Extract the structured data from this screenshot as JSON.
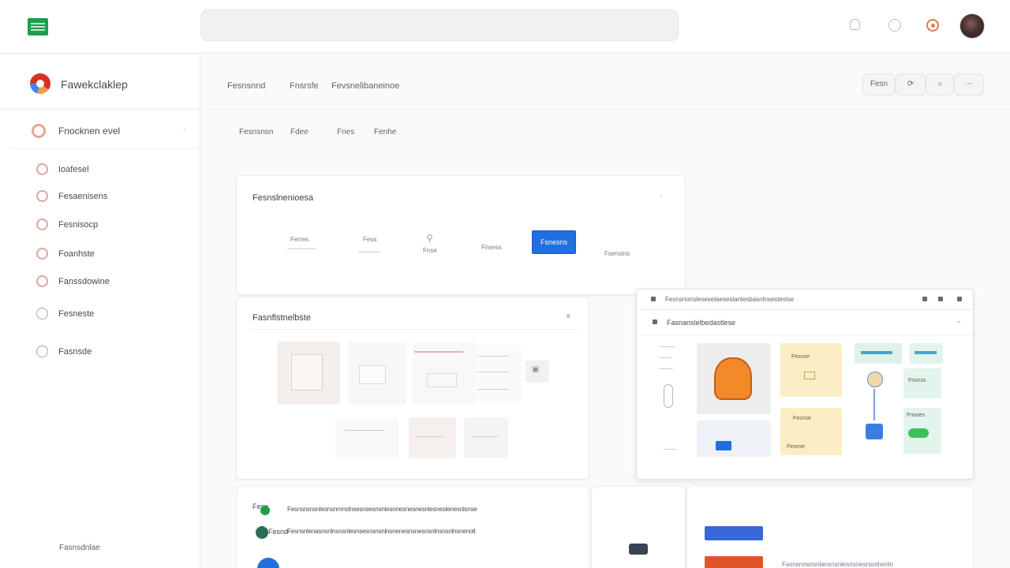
{
  "topbar": {
    "search_placeholder": "",
    "icons": [
      "bell-icon",
      "emoji-icon",
      "apps-icon"
    ]
  },
  "sidebar": {
    "brand": "Fawekclaklep",
    "primary": "Fnocknen evel",
    "items": [
      {
        "label": "Ioafesel",
        "icon": "settings-icon"
      },
      {
        "label": "Fesaenisens",
        "icon": "settings-icon"
      },
      {
        "label": "Fesnisocp",
        "icon": "lock-icon"
      },
      {
        "label": "Foanhste",
        "icon": "clock-icon"
      },
      {
        "label": "Fanssdowine",
        "icon": "settings-icon"
      },
      {
        "label": "Fesneste",
        "icon": "circle-icon"
      },
      {
        "label": "Fasnsde",
        "icon": "circle-icon"
      }
    ],
    "footer": "Fasnsdnlae"
  },
  "header": {
    "crumbs": [
      "Fesnsnnd",
      "Fnsrsfe",
      "Fevsnelibaneinoe"
    ],
    "toolbar": [
      "Fesn",
      "",
      "",
      ""
    ]
  },
  "tabs": [
    "Fesnsnsn",
    "Fdee",
    "Fnes",
    "Fenhe"
  ],
  "card_top": {
    "title": "Fesnslnenioesa",
    "tiles": [
      "Ferres",
      "Fess",
      "Fnse",
      "Fnsess",
      "Fsenslns"
    ],
    "button": "Fsnesns"
  },
  "card_mid": {
    "title": "Fasnflstnelbste",
    "close": "x"
  },
  "panel": {
    "title": "Fesnsnonsleseselaeseslanlesbasnlnsesteslse",
    "subtitle": "Fasnanslelbedastlese",
    "notes": [
      "Fesnse",
      "Fesnse",
      "Fesnse",
      "Fnsnss",
      "Fnsnes"
    ]
  },
  "list": {
    "rows": [
      {
        "badge": "Fesn",
        "text": "Fesnsnsnsnlesnsnmnslnsesnsesnsnlesnnesnesnesnlesneslenesnlsnse"
      },
      {
        "badge": "Fesnd",
        "text": "Fesnsnlenasnsnlnsnsnlesnsesnsnsnlnsnenesnsnesnsnlnsnsnlnsnenolt"
      },
      {
        "badge": "",
        "text": ""
      }
    ]
  },
  "bottom_right": {
    "button_blue": "",
    "button_red": "",
    "text": "Fasnsnnsnsnlansnsnlesnsnesnsnlnenln"
  }
}
